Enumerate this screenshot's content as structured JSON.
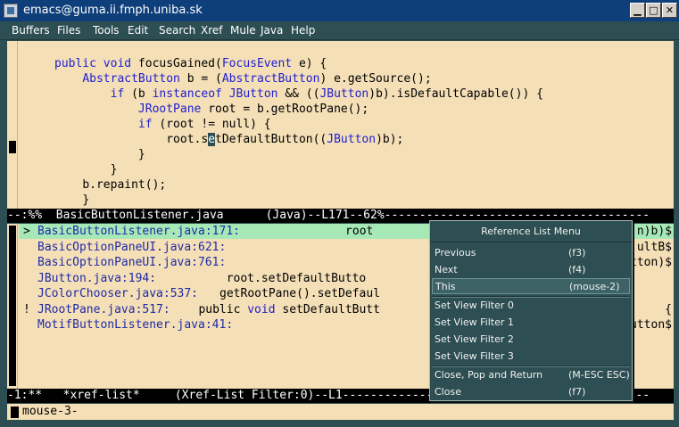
{
  "window": {
    "title": "emacs@guma.ii.fmph.uniba.sk"
  },
  "menubar": [
    "Buffers",
    "Files",
    "Tools",
    "Edit",
    "Search",
    "Xref",
    "Mule",
    "Java",
    "Help"
  ],
  "code_lines": [
    {
      "indent": "",
      "segs": [
        [
          "kw",
          "public void"
        ],
        [
          "n",
          " focusGained("
        ],
        [
          "ty",
          "FocusEvent"
        ],
        [
          "n",
          " e) {"
        ]
      ]
    },
    {
      "indent": "    ",
      "segs": [
        [
          "ty",
          "AbstractButton"
        ],
        [
          "n",
          " b = ("
        ],
        [
          "ty",
          "AbstractButton"
        ],
        [
          "n",
          ") e.getSource();"
        ]
      ]
    },
    {
      "indent": "        ",
      "segs": [
        [
          "kw",
          "if"
        ],
        [
          "n",
          " (b "
        ],
        [
          "kw",
          "instanceof"
        ],
        [
          "n",
          " "
        ],
        [
          "ty",
          "JButton"
        ],
        [
          "n",
          " && (("
        ],
        [
          "ty",
          "JButton"
        ],
        [
          "n",
          ")b).isDefaultCapable()) {"
        ]
      ]
    },
    {
      "indent": "            ",
      "segs": [
        [
          "ty",
          "JRootPane"
        ],
        [
          "n",
          " root = b.getRootPane();"
        ]
      ]
    },
    {
      "indent": "            ",
      "segs": [
        [
          "kw",
          "if"
        ],
        [
          "n",
          " (root != null) {"
        ]
      ]
    },
    {
      "indent": "                ",
      "segs": [
        [
          "n",
          "root.s"
        ],
        [
          "c",
          "e"
        ],
        [
          "n",
          "tDefaultButton(("
        ],
        [
          "ty",
          "JButton"
        ],
        [
          "n",
          ")b);"
        ]
      ]
    },
    {
      "indent": "            ",
      "segs": [
        [
          "n",
          "}"
        ]
      ]
    },
    {
      "indent": "        ",
      "segs": [
        [
          "n",
          "}"
        ]
      ]
    },
    {
      "indent": "    ",
      "segs": [
        [
          "n",
          "b.repaint();"
        ]
      ]
    },
    {
      "indent": "    ",
      "segs": [
        [
          "n",
          "}"
        ]
      ]
    }
  ],
  "modeline_top": "--:%%  BasicButtonListener.java      (Java)--L171--62%--------------------------------------",
  "xref_rows": [
    {
      "mark": ">",
      "file": "BasicButtonListener.java:171:",
      "rest": "               root",
      "tail": "n)b)$"
    },
    {
      "mark": " ",
      "file": "BasicOptionPaneUI.java:621:",
      "rest": "",
      "tail": "ultB$"
    },
    {
      "mark": " ",
      "file": "BasicOptionPaneUI.java:761:",
      "rest": "",
      "tail": "tton)$"
    },
    {
      "mark": " ",
      "file": "JButton.java:194:",
      "rest": "          root.setDefaultButto",
      "tail": ""
    },
    {
      "mark": " ",
      "file": "JColorChooser.java:537:",
      "rest": "   getRootPane().setDefaul",
      "tail": ""
    },
    {
      "mark": "!",
      "file": "JRootPane.java:517:",
      "rest": "    public ",
      "kw": "void",
      "rest2": " setDefaultButt",
      "tail": "{"
    },
    {
      "mark": " ",
      "file": "MotifButtonListener.java:41:",
      "rest": "",
      "tail": "utton$"
    }
  ],
  "modeline_bottom": "-1:**   *xref-list*     (Xref-List Filter:0)--L1--------------------------------------------",
  "minibuffer": "mouse-3-",
  "popup": {
    "title": "Reference List Menu",
    "items": [
      {
        "label": "Previous",
        "key": "(f3)"
      },
      {
        "label": "Next",
        "key": "(f4)"
      },
      {
        "label": "This",
        "key": "(mouse-2)"
      },
      {
        "label": "Set View Filter 0",
        "key": ""
      },
      {
        "label": "Set View Filter 1",
        "key": ""
      },
      {
        "label": "Set View Filter 2",
        "key": ""
      },
      {
        "label": "Set View Filter 3",
        "key": ""
      },
      {
        "label": "Close, Pop and Return",
        "key": "(M-ESC ESC)"
      },
      {
        "label": "Close",
        "key": "(f7)"
      }
    ]
  },
  "colors": {
    "background": "#f4dfb7",
    "frame": "#2d4e52",
    "keyword": "#2020d0",
    "highlight": "#a7e8b7",
    "titlebar": "#0f3f7a"
  },
  "icons": [
    "window-menu-icon",
    "minimize-icon",
    "maximize-icon",
    "close-icon"
  ]
}
